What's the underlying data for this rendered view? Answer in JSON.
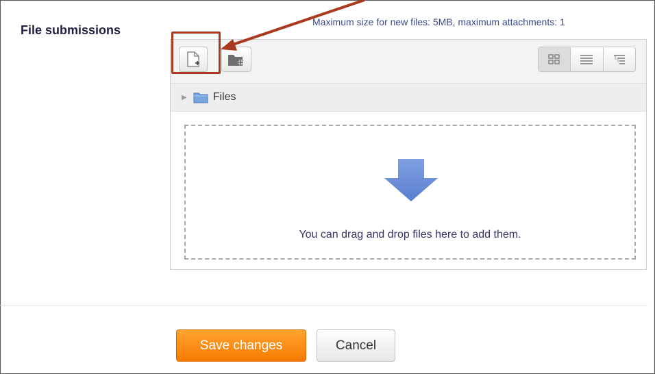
{
  "form": {
    "label": "File submissions",
    "max_size_text": "Maximum size for new files: 5MB, maximum attachments: 1"
  },
  "filepicker": {
    "toolbar": {
      "add_icon": "add-file-icon",
      "create_folder_icon": "create-folder-icon",
      "view_icons": [
        "grid-view-icon",
        "list-view-icon",
        "tree-view-icon"
      ]
    },
    "path": {
      "folder_label": "Files",
      "folder_icon": "folder-icon"
    },
    "dropzone": {
      "icon": "down-arrow-icon",
      "text": "You can drag and drop files here to add them."
    }
  },
  "actions": {
    "save_label": "Save changes",
    "cancel_label": "Cancel"
  },
  "colors": {
    "primary_button": "#f98e12",
    "annotation": "#a93a1f",
    "drop_arrow": "#6b8fd8",
    "label_text": "#222244"
  }
}
